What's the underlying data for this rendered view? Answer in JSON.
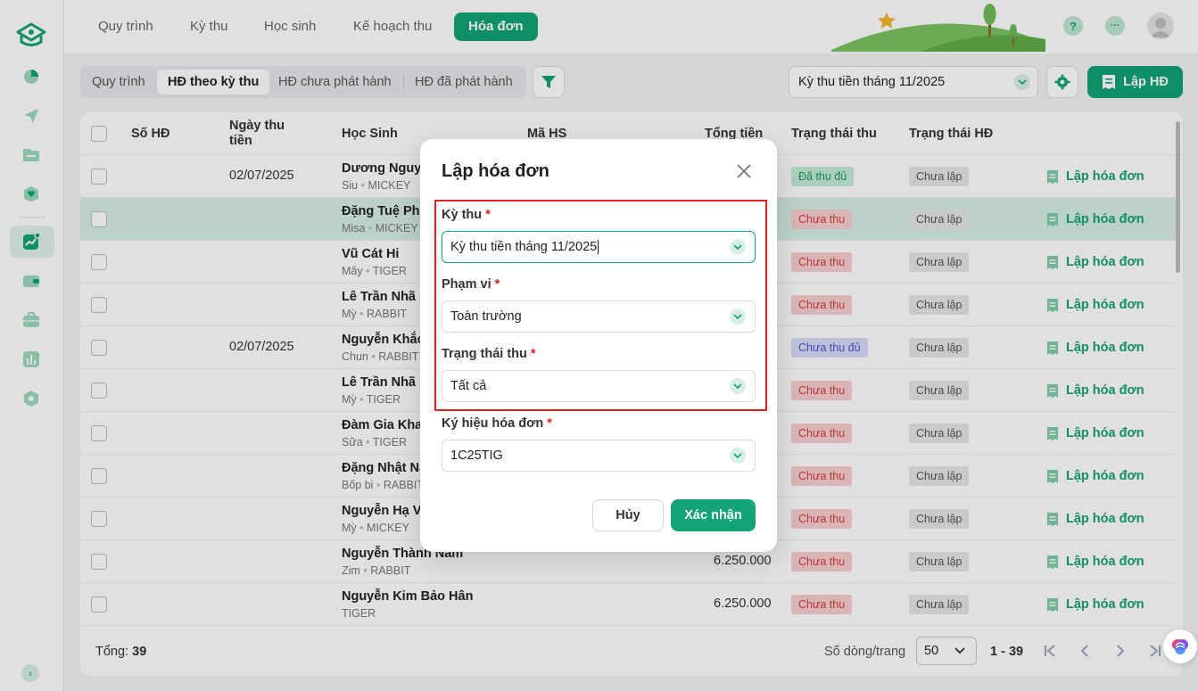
{
  "nav": {
    "tabs": [
      {
        "label": "Quy trình"
      },
      {
        "label": "Kỳ thu"
      },
      {
        "label": "Học sinh"
      },
      {
        "label": "Kế hoạch thu"
      },
      {
        "label": "Hóa đơn"
      }
    ],
    "active_tab": "Hóa đơn",
    "help_label": "?",
    "more_label": "···"
  },
  "toolbar": {
    "subtabs": [
      {
        "label": "Quy trình"
      },
      {
        "label": "HĐ theo kỳ thu"
      },
      {
        "label": "HĐ chưa phát hành"
      },
      {
        "label": "HĐ đã phát hành"
      }
    ],
    "active_subtab": "HĐ theo kỳ thu",
    "period_value": "Kỳ thu tiền tháng 11/2025",
    "create_label": "Lập HĐ"
  },
  "table": {
    "headers": {
      "so_hd": "Số HĐ",
      "ngay_thu": "Ngày thu tiền",
      "hoc_sinh": "Học Sinh",
      "ma_hs": "Mã HS",
      "tong_tien": "Tổng tiền",
      "trang_thai_thu": "Trạng thái thu",
      "trang_thai_hd": "Trạng thái HĐ"
    },
    "rows": [
      {
        "date": "02/07/2025",
        "name": "Dương Nguy",
        "nick": "Siu",
        "cls": "MICKEY",
        "total": "",
        "pay": "Đã thu đủ",
        "pay_type": "paid",
        "inv": "Chưa lập",
        "action": "Lập hóa đơn"
      },
      {
        "date": "",
        "name": "Đặng Tuệ Phu",
        "nick": "Misa",
        "cls": "MICKEY",
        "total": "",
        "pay": "Chưa thu",
        "pay_type": "unpaid",
        "inv": "Chưa lập",
        "action": "Lập hóa đơn"
      },
      {
        "date": "",
        "name": "Vũ Cát Hi",
        "nick": "Mây",
        "cls": "TIGER",
        "total": "",
        "pay": "Chưa thu",
        "pay_type": "unpaid",
        "inv": "Chưa lập",
        "action": "Lập hóa đơn"
      },
      {
        "date": "",
        "name": "Lê Trần Nhã I",
        "nick": "Mỳ",
        "cls": "RABBIT",
        "total": "",
        "pay": "Chưa thu",
        "pay_type": "unpaid",
        "inv": "Chưa lập",
        "action": "Lập hóa đơn"
      },
      {
        "date": "02/07/2025",
        "name": "Nguyễn Khắc",
        "nick": "Chun",
        "cls": "RABBIT",
        "total": "",
        "pay": "Chưa thu đủ",
        "pay_type": "partial",
        "inv": "Chưa lập",
        "action": "Lập hóa đơn"
      },
      {
        "date": "",
        "name": "Lê Trần Nhã I",
        "nick": "Mỳ",
        "cls": "TIGER",
        "total": "",
        "pay": "Chưa thu",
        "pay_type": "unpaid",
        "inv": "Chưa lập",
        "action": "Lập hóa đơn"
      },
      {
        "date": "",
        "name": "Đàm Gia Kha",
        "nick": "Sữa",
        "cls": "TIGER",
        "total": "",
        "pay": "Chưa thu",
        "pay_type": "unpaid",
        "inv": "Chưa lập",
        "action": "Lập hóa đơn"
      },
      {
        "date": "",
        "name": "Đặng Nhật Na",
        "nick": "Bốp bi",
        "cls": "RABBIT",
        "total": "",
        "pay": "Chưa thu",
        "pay_type": "unpaid",
        "inv": "Chưa lập",
        "action": "Lập hóa đơn"
      },
      {
        "date": "",
        "name": "Nguyễn Hạ V",
        "nick": "Mỳ",
        "cls": "MICKEY",
        "total": "",
        "pay": "Chưa thu",
        "pay_type": "unpaid",
        "inv": "Chưa lập",
        "action": "Lập hóa đơn"
      },
      {
        "date": "",
        "name": "Nguyễn Thành Nam",
        "nick": "Zim",
        "cls": "RABBIT",
        "total": "6.250.000",
        "pay": "Chưa thu",
        "pay_type": "unpaid",
        "inv": "Chưa lập",
        "action": "Lập hóa đơn"
      },
      {
        "date": "",
        "name": "Nguyễn Kim Bảo Hân",
        "nick": "",
        "cls": "TIGER",
        "total": "6.250.000",
        "pay": "Chưa thu",
        "pay_type": "unpaid",
        "inv": "Chưa lập",
        "action": "Lập hóa đơn"
      }
    ]
  },
  "footer": {
    "total_label": "Tổng:",
    "total_value": "39",
    "rows_per_page_label": "Số dòng/trang",
    "rows_per_page_value": "50",
    "range": "1 - 39"
  },
  "modal": {
    "title": "Lập hóa đơn",
    "fields": [
      {
        "label": "Kỳ thu",
        "value": "Kỳ thu tiền tháng 11/2025"
      },
      {
        "label": "Phạm vi",
        "value": "Toàn trường"
      },
      {
        "label": "Trạng thái thu",
        "value": "Tất cả"
      },
      {
        "label": "Ký hiệu hóa đơn",
        "value": "1C25TIG"
      }
    ],
    "required_mark": "*",
    "cancel_label": "Hủy",
    "confirm_label": "Xác nhận"
  },
  "colors": {
    "primary": "#12a376",
    "paid_bg": "#c5ebd8",
    "unpaid_bg": "#f8cfcf",
    "partial_bg": "#d6dcfa",
    "highlight_box": "#e02020"
  }
}
